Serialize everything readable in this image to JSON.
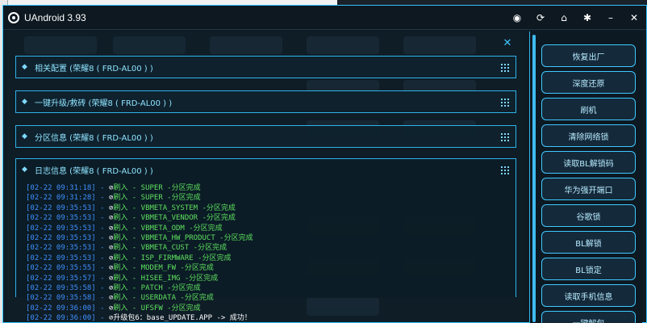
{
  "app": {
    "title": "UAndroid 3.93"
  },
  "titlebar": {
    "icons": [
      "globe-icon",
      "refresh-icon",
      "home-icon",
      "settings-icon",
      "minimize-icon",
      "close-icon"
    ],
    "glyphs": [
      "◉",
      "⟳",
      "⌂",
      "✱",
      "–",
      "✕"
    ]
  },
  "sections": [
    {
      "label": "相关配置 (荣耀8 ( FRD-AL00 ) )"
    },
    {
      "label": "一键升级/救砖 (荣耀8 ( FRD-AL00 ) )"
    },
    {
      "label": "分区信息 (荣耀8 ( FRD-AL00 ) )"
    }
  ],
  "log": {
    "title": "日志信息 (荣耀8 ( FRD-AL00 ) )",
    "lines": [
      {
        "ts": "[02-22 09:31:18]",
        "msg": "刷入 - SUPER -分区完成"
      },
      {
        "ts": "[02-22 09:31:28]",
        "msg": "刷入 - SUPER -分区完成"
      },
      {
        "ts": "[02-22 09:35:53]",
        "msg": "刷入 - VBMETA_SYSTEM -分区完成"
      },
      {
        "ts": "[02-22 09:35:53]",
        "msg": "刷入 - VBMETA_VENDOR -分区完成"
      },
      {
        "ts": "[02-22 09:35:53]",
        "msg": "刷入 - VBMETA_ODM -分区完成"
      },
      {
        "ts": "[02-22 09:35:53]",
        "msg": "刷入 - VBMETA_HW_PRODUCT -分区完成"
      },
      {
        "ts": "[02-22 09:35:53]",
        "msg": "刷入 - VBMETA_CUST -分区完成"
      },
      {
        "ts": "[02-22 09:35:53]",
        "msg": "刷入 - ISP_FIRMWARE -分区完成"
      },
      {
        "ts": "[02-22 09:35:55]",
        "msg": "刷入 - MODEM_FW -分区完成"
      },
      {
        "ts": "[02-22 09:35:57]",
        "msg": "刷入 - HISEE_IMG -分区完成"
      },
      {
        "ts": "[02-22 09:35:58]",
        "msg": "刷入 - PATCH -分区完成"
      },
      {
        "ts": "[02-22 09:35:58]",
        "msg": "刷入 - USERDATA -分区完成"
      },
      {
        "ts": "[02-22 09:36:00]",
        "msg": "刷入 - UFSFW -分区完成"
      },
      {
        "ts": "[02-22 09:36:00]",
        "msg": "升级包6：base_UPDATE.APP -> 成功！",
        "final": true
      }
    ]
  },
  "sidebar": {
    "buttons": [
      "恢复出厂",
      "深度还原",
      "刷机",
      "清除网络锁",
      "读取BL解锁码",
      "华为强开端口",
      "谷歌锁",
      "BL解锁",
      "BL锁定",
      "读取手机信息",
      "一键解包"
    ]
  },
  "colors": {
    "accent": "#2fb3e8",
    "log_ok": "#5ee05e",
    "timestamp": "#3f90ff"
  }
}
